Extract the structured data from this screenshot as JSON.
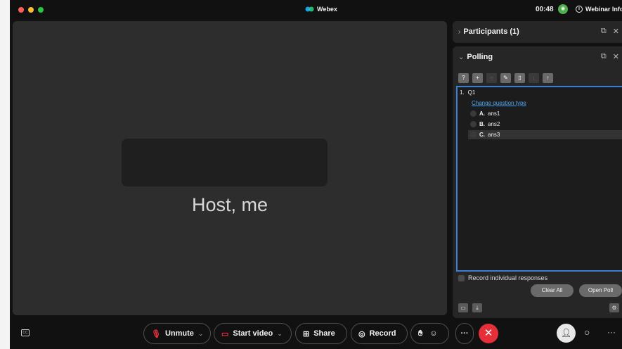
{
  "titlebar": {
    "title": "Webex",
    "timer": "00:48",
    "webinar_info": "Webinar Info"
  },
  "stage": {
    "participant_name": "Host, me"
  },
  "participants_panel": {
    "title": "Participants (1)"
  },
  "polling_panel": {
    "title": "Polling",
    "question_number": "1.",
    "question": "Q1",
    "change_type_link": "Change question type",
    "answers": [
      {
        "letter": "A.",
        "text": "ans1"
      },
      {
        "letter": "B.",
        "text": "ans2"
      },
      {
        "letter": "C.",
        "text": "ans3"
      }
    ],
    "record_individual": "Record individual responses",
    "clear_all": "Clear All",
    "open_poll": "Open Poll"
  },
  "controls": {
    "unmute": "Unmute",
    "start_video": "Start video",
    "share": "Share",
    "record": "Record"
  },
  "colors": {
    "accent": "#3b7fd4",
    "leave": "#e5303a",
    "link": "#4ba7f5"
  }
}
